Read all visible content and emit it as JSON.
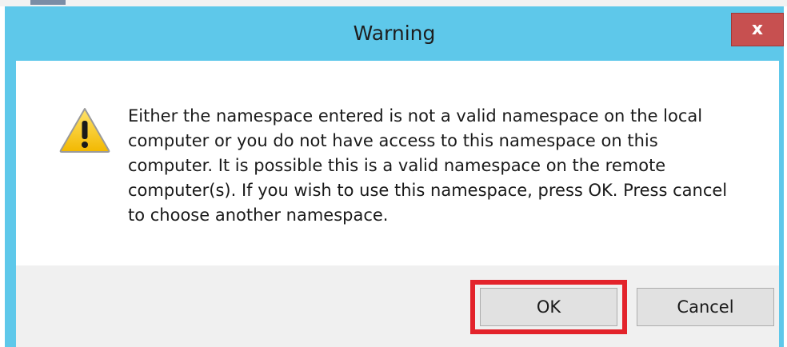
{
  "dialog": {
    "title": "Warning",
    "close_label": "x",
    "message": "Either the namespace entered is not a valid namespace on the local\ncomputer or you do not have access to this namespace on this\ncomputer.  It is possible this is a valid namespace on the remote\ncomputer(s).  If you wish to use this namespace, press OK.  Press cancel\nto choose another namespace.",
    "icon": "warning-triangle-icon",
    "buttons": {
      "ok_label": "OK",
      "cancel_label": "Cancel"
    }
  },
  "colors": {
    "title_bar": "#5ec8ea",
    "close_button": "#c75050",
    "highlight": "#e3232b",
    "warning_fill": "#f5c400"
  }
}
